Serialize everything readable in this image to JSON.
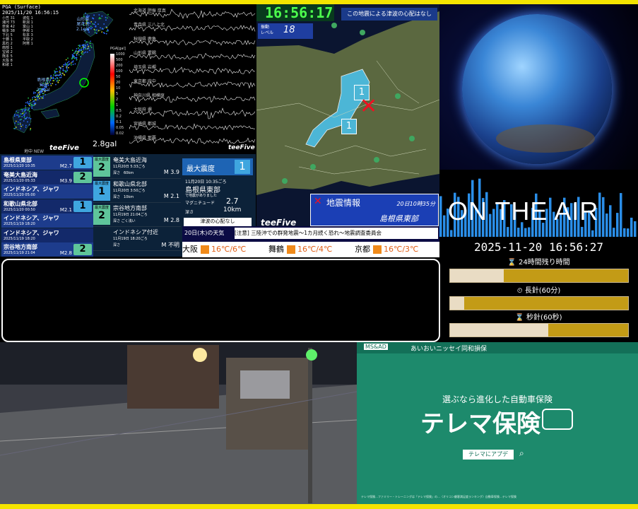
{
  "map": {
    "header_line1": "PGA (Surface)",
    "header_line2": "2025/11/20 16:56:15",
    "legend_left": [
      "小笠 31",
      "浦河 73",
      "奈良 42",
      "幡多 38",
      "下北 5",
      "十勝 1",
      "黒石 2",
      "南部 1",
      "宝城 2",
      "熊本 5",
      "大阪 8",
      "和歌 1"
    ],
    "legend_right": [
      "波佐 1",
      "新潟 1",
      "富山 1",
      "伊那 1",
      "松本 3",
      "平取 2",
      "阿寒 1"
    ],
    "label_shimane_a": "島根県",
    "label_shimane_b": "安来",
    "label_shimane_val": "2.8gal",
    "label_yamato_a": "山形県",
    "label_yamato_b": "尾花沢",
    "label_yamato_val": "2.1gal",
    "label_pga": "PGA[gal]",
    "scale_values": [
      "1000",
      "500",
      "200",
      "100",
      "50",
      "20",
      "10",
      "5",
      "2",
      "1",
      "0.5",
      "0.2",
      "0.1",
      "0.05",
      "0.02"
    ],
    "current_gal": "2.8gal",
    "footer_left": "地中 NEW",
    "brand": "teeFive"
  },
  "seis": {
    "labels": [
      "北海道 胆振 厚真",
      "青森県 三八上北",
      "秋田県 鹿角",
      "山形県 置賜",
      "埼玉県 岩槻",
      "東京都 府中",
      "神奈川県 相模原",
      "大阪府 堺",
      "宮崎県 都城",
      "沖縄県 那覇"
    ],
    "brand": "teeFive"
  },
  "eq": {
    "clock": "16:56:17",
    "tsunami_msg": "この地震による津波の心配はなし",
    "shindo_label": "振動\nレベル",
    "shindo_value": "18",
    "shindo_1": "1",
    "shindo_2": "1",
    "info_title": "地震情報",
    "info_time": "20日10時35分",
    "info_place": "島根県東部",
    "brand": "teeFive"
  },
  "earth": {
    "on_air": "ON THE AIR"
  },
  "air": {
    "datetime": "2025-11-20 16:56:27",
    "bar1_label": "24時間残り時間",
    "bar1_fraction": 0.3,
    "bar2_label": "長針(60分)",
    "bar2_fraction": 0.08,
    "bar3_label": "秒針(60秒)",
    "bar3_fraction": 0.55
  },
  "list": {
    "rows": [
      {
        "name": "島根県東部",
        "date": "2025/11/20 10:35",
        "mag": "M2.7",
        "lvl": "1",
        "color": "#3fa6df"
      },
      {
        "name": "奄美大島近海",
        "date": "2025/11/20 05:33",
        "mag": "M3.9",
        "lvl": "2",
        "color": "#5fc59a"
      },
      {
        "name": "インドネシア、ジャワ",
        "date": "2025/11/20 05:00",
        "mag": "",
        "lvl": "",
        "color": ""
      },
      {
        "name": "和歌山県北部",
        "date": "2025/11/20 00:50",
        "mag": "M2.1",
        "lvl": "1",
        "color": "#3fa6df"
      },
      {
        "name": "インドネシア、ジャワ",
        "date": "2025/11/19 18:20",
        "mag": "",
        "lvl": "",
        "color": ""
      },
      {
        "name": "インドネシア、ジャワ",
        "date": "2025/11/19 18:20",
        "mag": "",
        "lvl": "",
        "color": ""
      },
      {
        "name": "宗谷地方南部",
        "date": "2025/11/19 21:04",
        "mag": "M2.8",
        "lvl": "2",
        "color": "#5fc59a"
      }
    ],
    "mid": [
      {
        "lbl": "最大震度",
        "lvl": "2",
        "name": "奄美大島近海",
        "date": "11月20日 5:33ごろ",
        "depth": "深さ　60km",
        "mag": "M 3.9"
      },
      {
        "lbl": "最大震度",
        "lvl": "1",
        "name": "和歌山県北部",
        "date": "11月20日 3:50ごろ",
        "depth": "深さ　10km",
        "mag": "M 2.1"
      },
      {
        "lbl": "最大震度",
        "lvl": "2",
        "name": "宗谷地方南部",
        "date": "11月19日 21:04ごろ",
        "depth": "深さ ごく浅い",
        "mag": "M 2.8"
      },
      {
        "lbl": "",
        "lvl": "",
        "name": "インドネシア付近",
        "date": "11月19日 18:20ごろ",
        "depth": "深さ",
        "mag": "M 不明"
      }
    ],
    "max_label": "最大震度",
    "max_value": "1",
    "detail_date": "11月20日 10:35ごろ",
    "detail_place": "島根県東部",
    "detail_note": "で地震がありました",
    "detail_mag_label": "マグニチュード",
    "detail_mag": "2.7",
    "detail_depth_label": "深さ",
    "detail_depth": "10km",
    "detail_tsunami": "津波の心配なし"
  },
  "ticker": {
    "weather_title": "20日(木)の天気",
    "news": "[注意] 三陸沖での群発地震〜1カ月続く恐れ〜地震調査委員会",
    "cities": [
      {
        "city": "大阪",
        "temp": "16℃/6℃"
      },
      {
        "city": "舞鶴",
        "temp": "16℃/4℃"
      },
      {
        "city": "京都",
        "temp": "16℃/3℃"
      }
    ]
  },
  "ad": {
    "brand_tag": "MS&AD",
    "brand_name": "あいおいニッセイ同和損保",
    "tagline": "選ぶなら進化した自動車保険",
    "product": "テレマ保険",
    "search_text": "テレマにアプデ",
    "fine_print": "テレマ保険…ファミリー・トレーニングは「テレマ保険」の…〈オリコン顧客満足度ランキング〉自動車保険…テレマ保険"
  }
}
